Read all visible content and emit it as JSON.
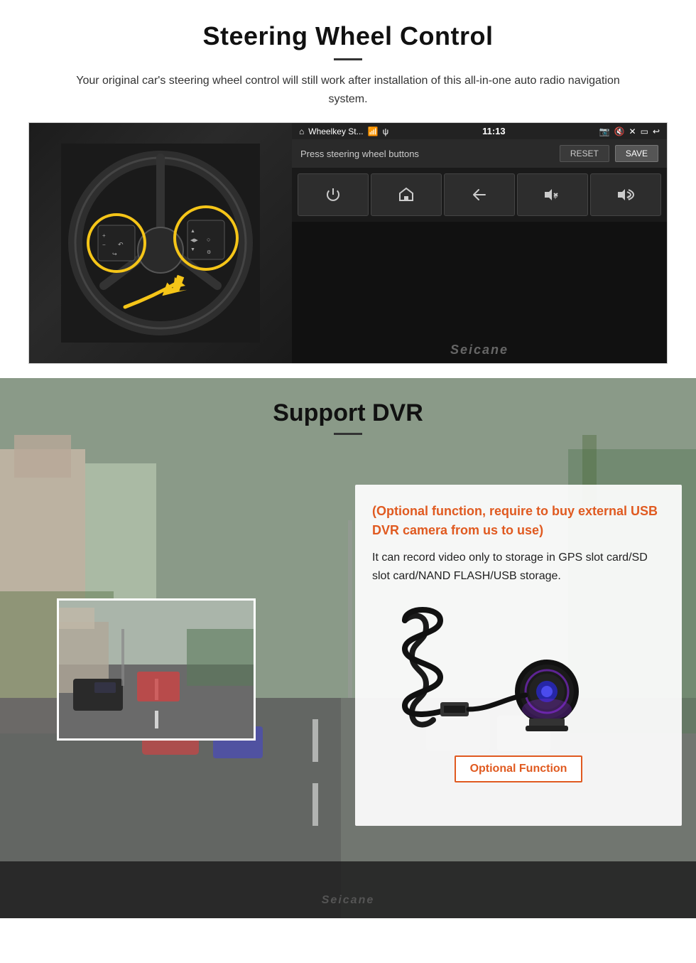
{
  "steering": {
    "title": "Steering Wheel Control",
    "divider": "—",
    "description": "Your original car's steering wheel control will still work after installation of this all-in-one auto radio navigation system.",
    "screen": {
      "app_name": "Wheelkey St...",
      "time": "11:13",
      "instruction": "Press steering wheel buttons",
      "reset_btn": "RESET",
      "save_btn": "SAVE",
      "buttons": [
        {
          "icon": "⏻",
          "label": "power"
        },
        {
          "icon": "⌂",
          "label": "home"
        },
        {
          "icon": "↩",
          "label": "back"
        },
        {
          "icon": "🔊+",
          "label": "vol-up"
        },
        {
          "icon": "🔊+",
          "label": "vol-up2"
        }
      ]
    },
    "watermark": "Seicane"
  },
  "dvr": {
    "title": "Support DVR",
    "optional_text": "(Optional function, require to buy external USB DVR camera from us to use)",
    "description": "It can record video only to storage in GPS slot card/SD slot card/NAND FLASH/USB storage.",
    "optional_function_label": "Optional Function",
    "watermark": "Seicane"
  }
}
